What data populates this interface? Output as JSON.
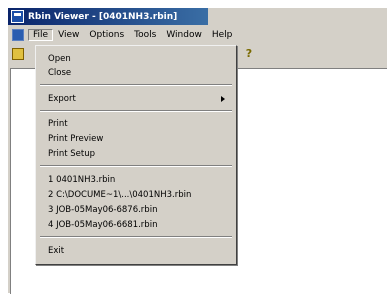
{
  "window": {
    "title": "Rbin Viewer - [0401NH3.rbin]"
  },
  "menubar": {
    "items": [
      "File",
      "View",
      "Options",
      "Tools",
      "Window",
      "Help"
    ]
  },
  "file_menu": {
    "open": "Open",
    "close": "Close",
    "export": "Export",
    "print": "Print",
    "print_preview": "Print Preview",
    "print_setup": "Print Setup",
    "recent": [
      "1 0401NH3.rbin",
      "2 C:\\DOCUME~1\\...\\0401NH3.rbin",
      "3 JOB-05May06-6876.rbin",
      "4 JOB-05May06-6681.rbin"
    ],
    "exit": "Exit"
  },
  "colors": {
    "titlebar_start": "#0a246a",
    "titlebar_end": "#3a6ea5",
    "chrome": "#d4d0c8"
  },
  "icons": [
    "app-icon",
    "mdi-child-icon",
    "open-folder-icon",
    "help-icon",
    "submenu-arrow-icon"
  ]
}
